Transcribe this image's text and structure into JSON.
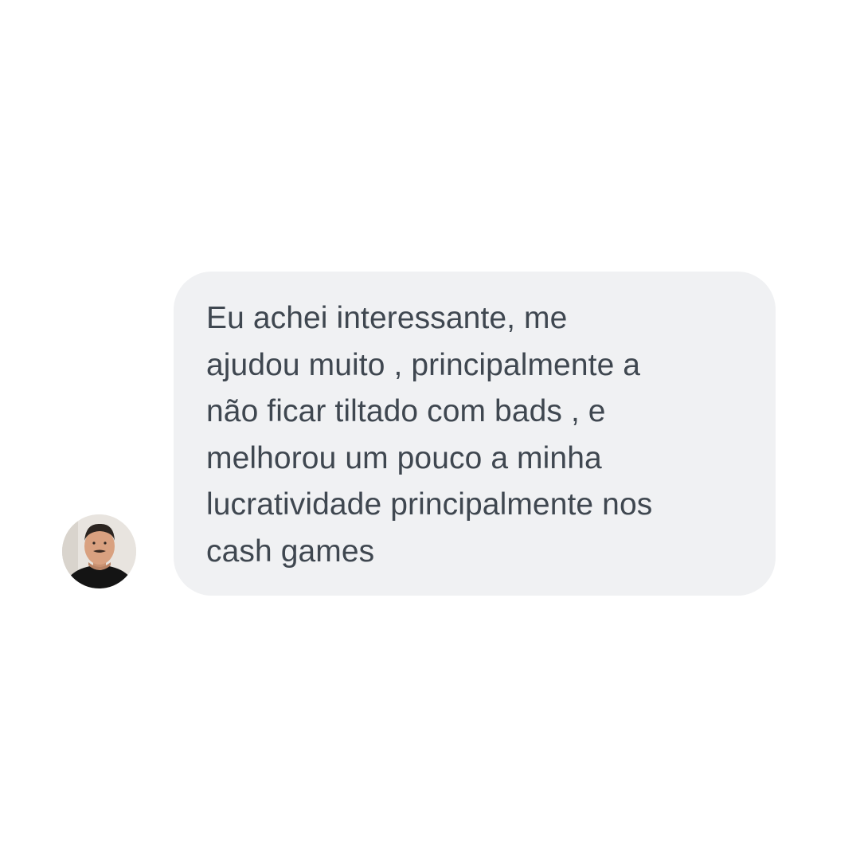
{
  "message": {
    "lines": [
      "Eu achei interessante, me",
      "ajudou muito , principalmente a",
      "não ficar tiltado com bads , e",
      "melhorou um pouco a minha",
      "lucratividade principalmente nos",
      "cash games"
    ],
    "bubble_color": "#f0f1f3",
    "text_color": "#3f4750"
  },
  "sender": {
    "avatar_icon": "user-avatar-photo"
  }
}
